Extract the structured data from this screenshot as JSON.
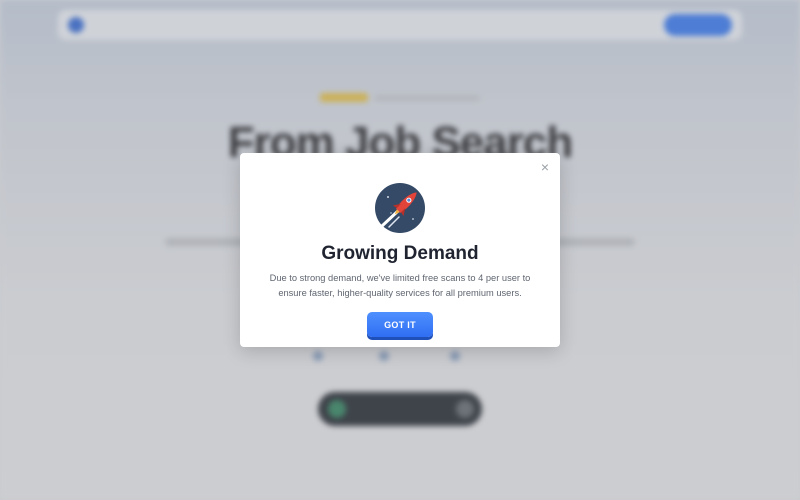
{
  "modal": {
    "title": "Growing Demand",
    "body": "Due to strong demand, we've limited free scans to 4 per user to ensure faster, higher-quality services for all premium users.",
    "button_label": "GOT IT",
    "close_icon": "×"
  },
  "icons": {
    "rocket": "rocket-icon",
    "close": "close-icon"
  },
  "background": {
    "hero_title": "From Job Search"
  },
  "colors": {
    "primary_button": "#3f7ef0",
    "rocket_circle": "#354a66",
    "rocket_body": "#e3443a",
    "title_text": "#1f2430"
  }
}
